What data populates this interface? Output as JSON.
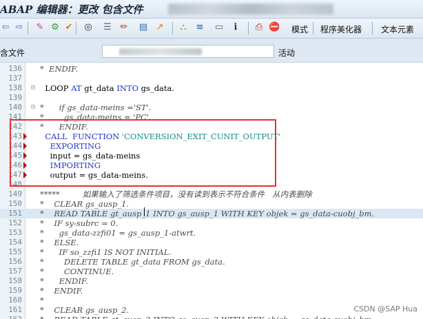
{
  "window": {
    "title": "ABAP 编辑器：更改 包含文件"
  },
  "toolbar": {
    "buttons": [
      {
        "name": "back-icon",
        "glyph": "⇦"
      },
      {
        "name": "forward-icon",
        "glyph": "⇨"
      },
      {
        "name": "syntax-check-icon",
        "glyph": "✎"
      },
      {
        "name": "activate-icon",
        "glyph": "⚙"
      },
      {
        "name": "check-icon",
        "glyph": "✔"
      },
      {
        "name": "where-used-icon",
        "glyph": "◎"
      },
      {
        "name": "object-list-icon",
        "glyph": "☰"
      },
      {
        "name": "pencil-icon",
        "glyph": "✏"
      },
      {
        "name": "display-change-icon",
        "glyph": "▤"
      },
      {
        "name": "navigate-icon",
        "glyph": "↗"
      },
      {
        "name": "hierarchy-icon",
        "glyph": "⛬"
      },
      {
        "name": "stack-icon",
        "glyph": "≡"
      },
      {
        "name": "screen-icon",
        "glyph": "▭"
      },
      {
        "name": "info-icon",
        "glyph": "ℹ"
      },
      {
        "name": "printer-icon",
        "glyph": "⎙"
      },
      {
        "name": "stop-icon",
        "glyph": "⛔"
      }
    ],
    "pattern_label": "模式",
    "pretty_printer_label": "程序美化器",
    "text_elements_label": "文本元素"
  },
  "include_row": {
    "label": "含文件",
    "status": "活动"
  },
  "editor": {
    "lines": [
      {
        "no": "136",
        "fold": "",
        "marker": false,
        "hl": false,
        "parts": [
          {
            "t": "*  ENDIF.",
            "c": "cmt"
          }
        ]
      },
      {
        "no": "137",
        "fold": "",
        "marker": false,
        "hl": false,
        "parts": [
          {
            "t": "",
            "c": "plain"
          }
        ]
      },
      {
        "no": "138",
        "fold": "⊟",
        "marker": false,
        "hl": false,
        "parts": [
          {
            "t": "  LOOP ",
            "c": "plain"
          },
          {
            "t": "AT",
            "c": "kw"
          },
          {
            "t": " gt_data ",
            "c": "plain"
          },
          {
            "t": "INTO",
            "c": "kw"
          },
          {
            "t": " gs_data.",
            "c": "plain"
          }
        ]
      },
      {
        "no": "139",
        "fold": "",
        "marker": false,
        "hl": false,
        "parts": [
          {
            "t": "",
            "c": "plain"
          }
        ]
      },
      {
        "no": "140",
        "fold": "⊟",
        "marker": false,
        "hl": false,
        "parts": [
          {
            "t": "*      if gs_data-meins ='ST'.",
            "c": "cmt"
          }
        ]
      },
      {
        "no": "141",
        "fold": "",
        "marker": false,
        "hl": false,
        "parts": [
          {
            "t": "*        gs_data-meins = 'PC'.",
            "c": "cmt"
          }
        ]
      },
      {
        "no": "142",
        "fold": "",
        "marker": false,
        "hl": false,
        "parts": [
          {
            "t": "*      ENDIF.",
            "c": "cmt"
          }
        ]
      },
      {
        "no": "143",
        "fold": "",
        "marker": true,
        "hl": false,
        "parts": [
          {
            "t": "  CALL  ",
            "c": "kw"
          },
          {
            "t": "FUNCTION ",
            "c": "kw"
          },
          {
            "t": "'CONVERSION_EXIT_CUNIT_OUTPUT'",
            "c": "str"
          }
        ]
      },
      {
        "no": "144",
        "fold": "",
        "marker": true,
        "hl": false,
        "parts": [
          {
            "t": "    EXPORTING",
            "c": "kw"
          }
        ]
      },
      {
        "no": "145",
        "fold": "",
        "marker": true,
        "hl": false,
        "parts": [
          {
            "t": "    input = gs_data-meins",
            "c": "plain"
          }
        ]
      },
      {
        "no": "146",
        "fold": "",
        "marker": true,
        "hl": false,
        "parts": [
          {
            "t": "    IMPORTING",
            "c": "kw"
          }
        ]
      },
      {
        "no": "147",
        "fold": "",
        "marker": true,
        "hl": false,
        "parts": [
          {
            "t": "    output = gs_data-meins.",
            "c": "plain"
          }
        ]
      },
      {
        "no": "148",
        "fold": "",
        "marker": false,
        "hl": false,
        "parts": [
          {
            "t": "",
            "c": "plain"
          }
        ]
      },
      {
        "no": "149",
        "fold": "",
        "marker": false,
        "hl": false,
        "parts": [
          {
            "t": "*****         如果输入了筛选条件项目，没有读到表示不符合条件   从内表删除",
            "c": "cmt"
          }
        ]
      },
      {
        "no": "150",
        "fold": "",
        "marker": false,
        "hl": false,
        "parts": [
          {
            "t": "*    CLEAR gs_ausp_1.",
            "c": "cmt"
          }
        ]
      },
      {
        "no": "151",
        "fold": "",
        "marker": false,
        "hl": true,
        "parts": [
          {
            "t": "*    READ TABLE gt_ausp_1 INTO gs_ausp_1 WITH KEY objek = gs_data-cuobj_bm.",
            "c": "cmt"
          }
        ]
      },
      {
        "no": "152",
        "fold": "",
        "marker": false,
        "hl": false,
        "parts": [
          {
            "t": "*    IF sy-subrc = 0.",
            "c": "cmt"
          }
        ]
      },
      {
        "no": "153",
        "fold": "",
        "marker": false,
        "hl": false,
        "parts": [
          {
            "t": "*      gs_data-zzfi01 = gs_ausp_1-atwrt.",
            "c": "cmt"
          }
        ]
      },
      {
        "no": "154",
        "fold": "",
        "marker": false,
        "hl": false,
        "parts": [
          {
            "t": "*    ELSE.",
            "c": "cmt"
          }
        ]
      },
      {
        "no": "155",
        "fold": "",
        "marker": false,
        "hl": false,
        "parts": [
          {
            "t": "*      IF so_zzfi1 IS NOT INITIAL.",
            "c": "cmt"
          }
        ]
      },
      {
        "no": "156",
        "fold": "",
        "marker": false,
        "hl": false,
        "parts": [
          {
            "t": "*        DELETE TABLE gt_data FROM gs_data.",
            "c": "cmt"
          }
        ]
      },
      {
        "no": "157",
        "fold": "",
        "marker": false,
        "hl": false,
        "parts": [
          {
            "t": "*        CONTINUE.",
            "c": "cmt"
          }
        ]
      },
      {
        "no": "158",
        "fold": "",
        "marker": false,
        "hl": false,
        "parts": [
          {
            "t": "*      ENDIF.",
            "c": "cmt"
          }
        ]
      },
      {
        "no": "159",
        "fold": "",
        "marker": false,
        "hl": false,
        "parts": [
          {
            "t": "*    ENDIF.",
            "c": "cmt"
          }
        ]
      },
      {
        "no": "160",
        "fold": "",
        "marker": false,
        "hl": false,
        "parts": [
          {
            "t": "*",
            "c": "cmt"
          }
        ]
      },
      {
        "no": "161",
        "fold": "",
        "marker": false,
        "hl": false,
        "parts": [
          {
            "t": "*    CLEAR gs_ausp_2.",
            "c": "cmt"
          }
        ]
      },
      {
        "no": "162",
        "fold": "",
        "marker": false,
        "hl": false,
        "parts": [
          {
            "t": "*    READ TABLE gt_ausp_2 INTO gs_ausp_2 WITH KEY objek = gs_data-cuobj_bm.",
            "c": "cmt"
          }
        ]
      }
    ]
  },
  "watermark": "CSDN @SAP Hua",
  "colors": {
    "keyword": "#1c37c9",
    "string": "#168a8a",
    "comment": "#4a4a4a",
    "highlight_border": "#e53030",
    "marker": "#c00000"
  }
}
